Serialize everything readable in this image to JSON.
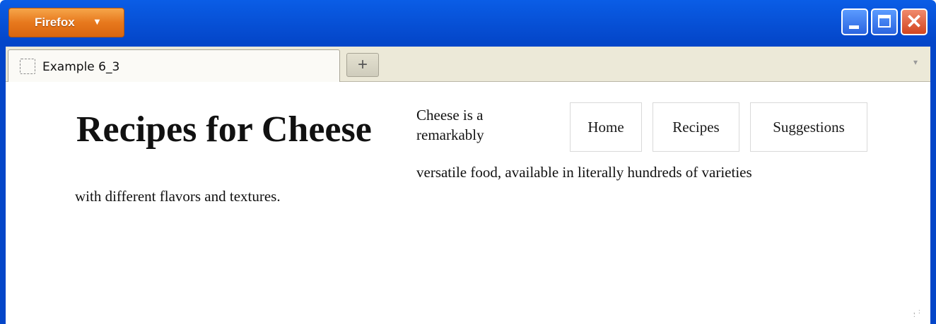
{
  "browser": {
    "menu_button_label": "Firefox",
    "menu_arrow_icon": "caret-down-icon",
    "window_controls": {
      "minimize_icon": "minimize-icon",
      "maximize_icon": "maximize-icon",
      "close_icon": "close-icon",
      "close_glyph": "✕"
    }
  },
  "tabs": [
    {
      "title": "Example 6_3",
      "icon": "page-placeholder-icon",
      "active": true
    }
  ],
  "new_tab_glyph": "+",
  "tab_list_glyph": "▾",
  "page": {
    "heading": "Recipes for Cheese",
    "nav": [
      "Home",
      "Recipes",
      "Suggestions"
    ],
    "paragraph_lines": [
      "Cheese is a",
      "remarkably",
      "versatile food, available in literally hundreds of varieties",
      "with different flavors and textures."
    ]
  },
  "colors": {
    "titlebar_blue": "#0446c9",
    "firefox_orange": "#e7781d",
    "tabstrip_bg": "#ece9d8",
    "close_red": "#d2451f"
  }
}
